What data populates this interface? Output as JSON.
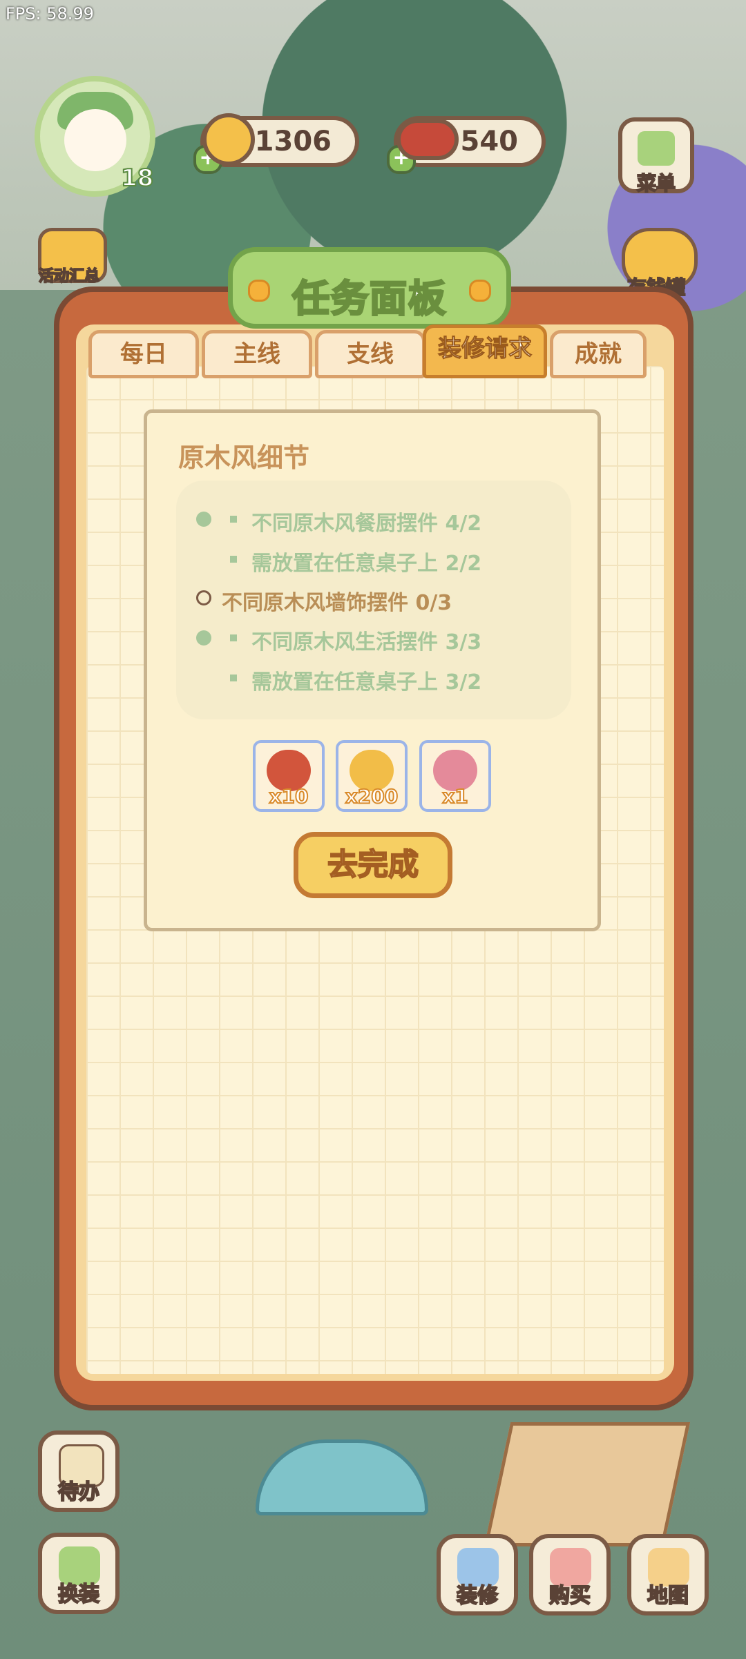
{
  "fps": "FPS: 58.99",
  "player": {
    "level": "18"
  },
  "resources": {
    "coins": "1306",
    "meat": "540"
  },
  "side_buttons": {
    "menu": "菜单",
    "events": "活动汇总",
    "piggy_bank": "存钱罐"
  },
  "panel": {
    "title": "任务面板",
    "tabs": [
      "每日",
      "主线",
      "支线",
      "装修请求",
      "成就"
    ],
    "active_tab": "装修请求"
  },
  "task": {
    "title": "原木风细节",
    "requirements": [
      {
        "text": "不同原木风餐厨摆件 4/2",
        "status": "done",
        "level": 1
      },
      {
        "text": "需放置在任意桌子上 2/2",
        "status": "done",
        "level": 2
      },
      {
        "text": "不同原木风墙饰摆件 0/3",
        "status": "todo",
        "level": 1
      },
      {
        "text": "不同原木风生活摆件 3/3",
        "status": "done",
        "level": 1
      },
      {
        "text": "需放置在任意桌子上 3/2",
        "status": "done",
        "level": 2
      }
    ],
    "rewards": [
      {
        "icon": "meat-icon",
        "qty": "x10"
      },
      {
        "icon": "coin-pile-icon",
        "qty": "x200"
      },
      {
        "icon": "gift-icon",
        "qty": "x1"
      }
    ],
    "action_button": "去完成"
  },
  "bottom_buttons": {
    "todo": "待办",
    "dress_up": "换装",
    "decorate": "装修",
    "buy": "购买",
    "map": "地图"
  },
  "colors": {
    "panel_border": "#c7693e",
    "active_tab": "#f3b84e",
    "done_text": "#a6c79a",
    "todo_text": "#b98e56",
    "button": "#f6cf63"
  }
}
